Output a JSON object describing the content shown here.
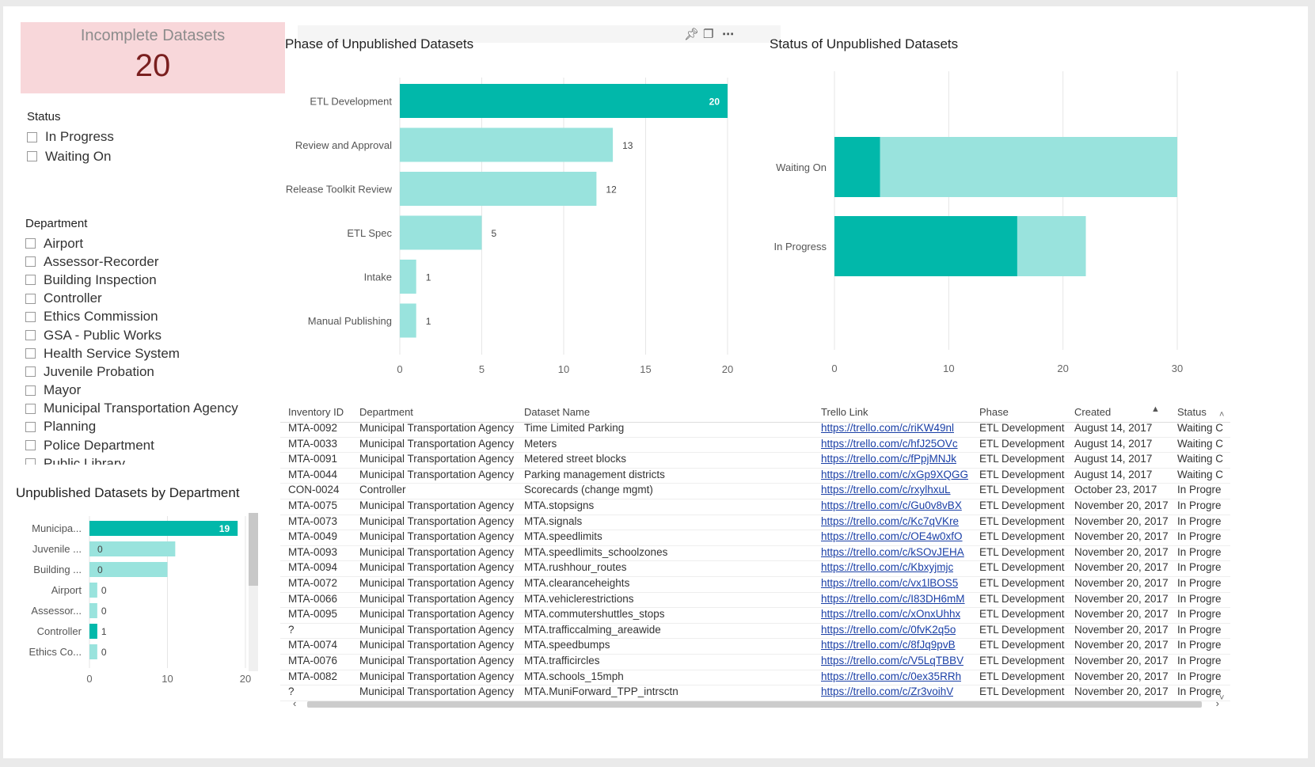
{
  "kpi": {
    "title": "Incomplete Datasets",
    "value": "20"
  },
  "status_slicer": {
    "title": "Status",
    "items": [
      "In Progress",
      "Waiting On"
    ]
  },
  "dept_slicer": {
    "title": "Department",
    "items": [
      "Airport",
      "Assessor-Recorder",
      "Building Inspection",
      "Controller",
      "Ethics Commission",
      "GSA - Public Works",
      "Health Service System",
      "Juvenile Probation",
      "Mayor",
      "Municipal Transportation Agency",
      "Planning",
      "Police Department",
      "Public Library"
    ]
  },
  "visual_header_icons": [
    "pin-icon",
    "focus-mode-icon",
    "more-options-icon"
  ],
  "colors": {
    "dark": "#01b8aa",
    "light": "#99e3dd",
    "kpi_bg": "#f8d7da",
    "kpi_value": "#7a1f1f"
  },
  "chart_data": [
    {
      "type": "bar",
      "orientation": "horizontal",
      "title": "Phase of Unpublished Datasets",
      "categories": [
        "ETL Development",
        "Review and Approval",
        "Release Toolkit Review",
        "ETL Spec",
        "Intake",
        "Manual Publishing"
      ],
      "values": [
        20,
        13,
        12,
        5,
        1,
        1
      ],
      "highlighted": [
        true,
        false,
        false,
        false,
        false,
        false
      ],
      "xlim": [
        0,
        20
      ],
      "xticks": [
        0,
        5,
        10,
        15,
        20
      ],
      "grid": true
    },
    {
      "type": "bar",
      "orientation": "horizontal",
      "stacked": true,
      "title": "Status of Unpublished Datasets",
      "categories": [
        "Waiting On",
        "In Progress"
      ],
      "series": [
        {
          "values": [
            4,
            16
          ]
        },
        {
          "values": [
            26,
            6
          ]
        }
      ],
      "xlim": [
        0,
        30
      ],
      "xticks": [
        0,
        10,
        20,
        30
      ],
      "grid": true
    },
    {
      "type": "bar",
      "orientation": "horizontal",
      "title": "Unpublished Datasets by Department",
      "categories": [
        "Municipa...",
        "Juvenile ...",
        "Building ...",
        "Airport",
        "Assessor...",
        "Controller",
        "Ethics Co..."
      ],
      "values": [
        19,
        0,
        0,
        0,
        0,
        1,
        0
      ],
      "background_values": [
        19,
        11,
        10,
        1,
        1,
        1,
        1
      ],
      "xlim": [
        0,
        20
      ],
      "xticks": [
        0,
        10,
        20
      ],
      "grid": true
    }
  ],
  "table": {
    "columns": [
      "Inventory ID",
      "Department",
      "Dataset Name",
      "Trello Link",
      "Phase",
      "Created",
      "Status"
    ],
    "rows": [
      [
        "MTA-0092",
        "Municipal Transportation Agency",
        "Time Limited Parking",
        "https://trello.com/c/riKW49nl",
        "ETL Development",
        "August 14, 2017",
        "Waiting C"
      ],
      [
        "MTA-0033",
        "Municipal Transportation Agency",
        "Meters",
        "https://trello.com/c/hfJ25OVc",
        "ETL Development",
        "August 14, 2017",
        "Waiting C"
      ],
      [
        "MTA-0091",
        "Municipal Transportation Agency",
        "Metered street blocks",
        "https://trello.com/c/fPpjMNJk",
        "ETL Development",
        "August 14, 2017",
        "Waiting C"
      ],
      [
        "MTA-0044",
        "Municipal Transportation Agency",
        "Parking management districts",
        "https://trello.com/c/xGp9XQGG",
        "ETL Development",
        "August 14, 2017",
        "Waiting C"
      ],
      [
        "CON-0024",
        "Controller",
        "Scorecards (change mgmt)",
        "https://trello.com/c/rxylhxuL",
        "ETL Development",
        "October 23, 2017",
        "In Progre"
      ],
      [
        "MTA-0075",
        "Municipal Transportation Agency",
        "MTA.stopsigns",
        "https://trello.com/c/Gu0v8vBX",
        "ETL Development",
        "November 20, 2017",
        "In Progre"
      ],
      [
        "MTA-0073",
        "Municipal Transportation Agency",
        "MTA.signals",
        "https://trello.com/c/Kc7qVKre",
        "ETL Development",
        "November 20, 2017",
        "In Progre"
      ],
      [
        "MTA-0049",
        "Municipal Transportation Agency",
        "MTA.speedlimits",
        "https://trello.com/c/OE4w0xfO",
        "ETL Development",
        "November 20, 2017",
        "In Progre"
      ],
      [
        "MTA-0093",
        "Municipal Transportation Agency",
        "MTA.speedlimits_schoolzones",
        "https://trello.com/c/kSOvJEHA",
        "ETL Development",
        "November 20, 2017",
        "In Progre"
      ],
      [
        "MTA-0094",
        "Municipal Transportation Agency",
        "MTA.rushhour_routes",
        "https://trello.com/c/Kbxyjmjc",
        "ETL Development",
        "November 20, 2017",
        "In Progre"
      ],
      [
        "MTA-0072",
        "Municipal Transportation Agency",
        "MTA.clearanceheights",
        "https://trello.com/c/vx1lBOS5",
        "ETL Development",
        "November 20, 2017",
        "In Progre"
      ],
      [
        "MTA-0066",
        "Municipal Transportation Agency",
        "MTA.vehiclerestrictions",
        "https://trello.com/c/I83DH6mM",
        "ETL Development",
        "November 20, 2017",
        "In Progre"
      ],
      [
        "MTA-0095",
        "Municipal Transportation Agency",
        "MTA.commutershuttles_stops",
        "https://trello.com/c/xOnxUhhx",
        "ETL Development",
        "November 20, 2017",
        "In Progre"
      ],
      [
        "?",
        "Municipal Transportation Agency",
        "MTA.trafficcalming_areawide",
        "https://trello.com/c/0fvK2q5o",
        "ETL Development",
        "November 20, 2017",
        "In Progre"
      ],
      [
        "MTA-0074",
        "Municipal Transportation Agency",
        "MTA.speedbumps",
        "https://trello.com/c/8fJq9pvB",
        "ETL Development",
        "November 20, 2017",
        "In Progre"
      ],
      [
        "MTA-0076",
        "Municipal Transportation Agency",
        "MTA.trafficircles",
        "https://trello.com/c/V5LqTBBV",
        "ETL Development",
        "November 20, 2017",
        "In Progre"
      ],
      [
        "MTA-0082",
        "Municipal Transportation Agency",
        "MTA.schools_15mph",
        "https://trello.com/c/0ex35RRh",
        "ETL Development",
        "November 20, 2017",
        "In Progre"
      ],
      [
        "?",
        "Municipal Transportation Agency",
        "MTA.MuniForward_TPP_intrsctn",
        "https://trello.com/c/Zr3voihV",
        "ETL Development",
        "November 20, 2017",
        "In Progre"
      ]
    ]
  }
}
